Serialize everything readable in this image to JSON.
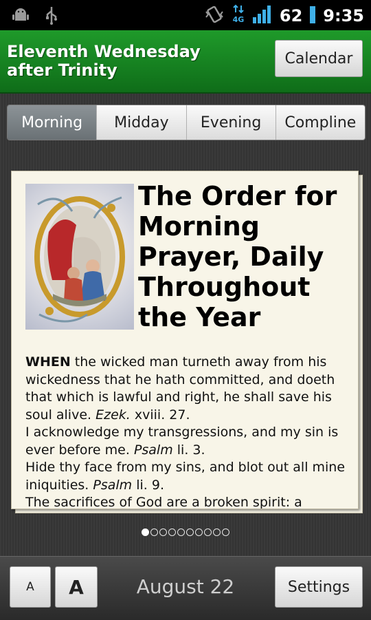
{
  "status_bar": {
    "battery": "62",
    "time": "9:35",
    "network": "4G",
    "icons": [
      "android-debug-icon",
      "usb-icon",
      "vibrate-icon",
      "network-4g-icon",
      "signal-icon",
      "battery-icon"
    ]
  },
  "header": {
    "title_line1": "Eleventh Wednesday",
    "title_line2": "after Trinity",
    "calendar_label": "Calendar"
  },
  "tabs": [
    {
      "label": "Morning",
      "active": true
    },
    {
      "label": "Midday",
      "active": false
    },
    {
      "label": "Evening",
      "active": false
    },
    {
      "label": "Compline",
      "active": false
    }
  ],
  "page": {
    "heading": "The Order for Morning Prayer, Daily Throughout the Year",
    "image": "illuminated-manuscript-illustration",
    "sentences": [
      {
        "lead": "WHEN",
        "text": " the wicked man turneth away from his wickedness that he hath committed, and doeth that which is lawful and right, he shall save his soul alive. ",
        "ref": "Ezek.",
        "chapter": " xviii. 27."
      },
      {
        "lead": "",
        "text": "I acknowledge my transgressions, and my sin is ever before me. ",
        "ref": "Psalm",
        "chapter": " li. 3."
      },
      {
        "lead": "",
        "text": "Hide thy face from my sins, and blot out all mine iniquities. ",
        "ref": "Psalm",
        "chapter": " li. 9."
      },
      {
        "lead": "",
        "text": "The sacrifices of God are a broken spirit: a",
        "ref": "",
        "chapter": ""
      }
    ]
  },
  "pager": {
    "count": 10,
    "active": 0
  },
  "footer": {
    "font_small": "A",
    "font_large": "A",
    "date": "August 22",
    "settings_label": "Settings"
  },
  "colors": {
    "header_green": "#16861f",
    "active_tab": "#7b8286",
    "paper": "#f8f5e8"
  }
}
